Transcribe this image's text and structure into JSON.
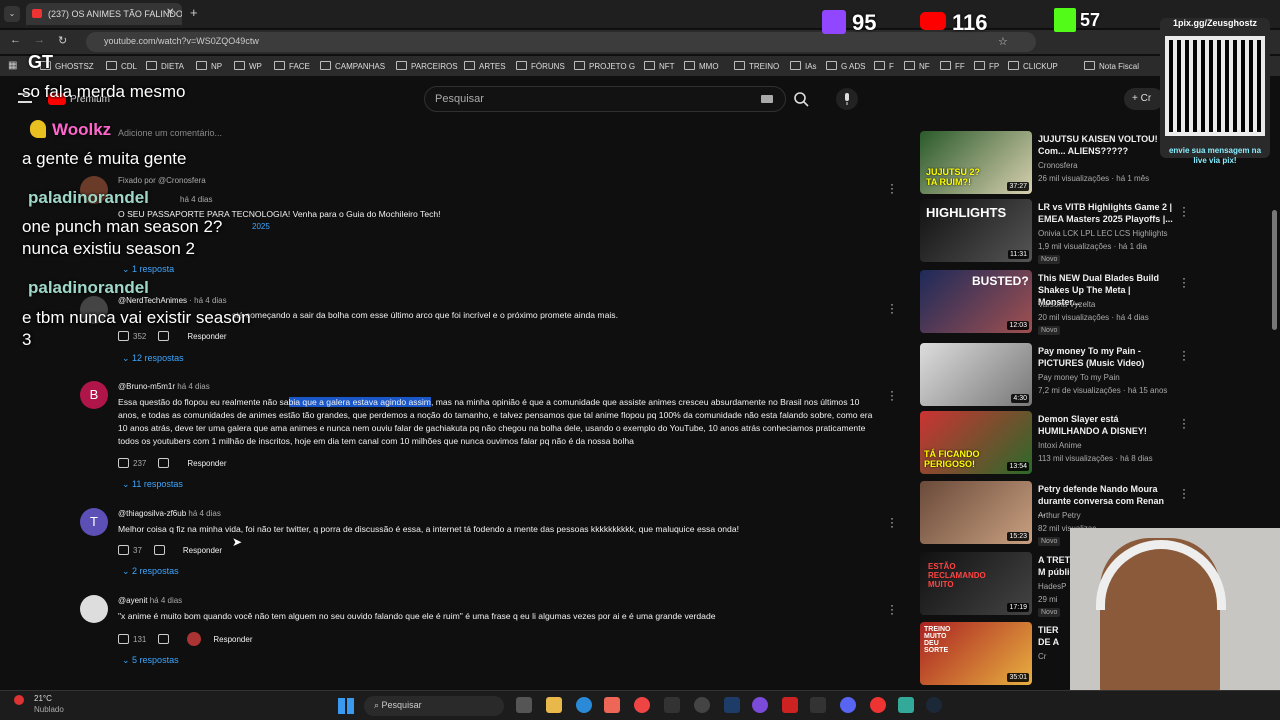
{
  "browser": {
    "tab_title": "(237) OS ANIMES TÃO FALINDO",
    "url": "youtube.com/watch?v=WS0ZQO49ctw"
  },
  "bookmarks": [
    "GHOSTSZ",
    "CDL",
    "DIETA",
    "NP",
    "WP",
    "FACE",
    "CAMPANHAS",
    "PARCEIROS",
    "ARTES",
    "FÓRUNS",
    "PROJETO G",
    "NFT",
    "MMO",
    "TREINO",
    "IAs",
    "G ADS",
    "F",
    "NF",
    "FF",
    "FP",
    "CLICKUP",
    "Nota Fiscal"
  ],
  "youtube": {
    "search_placeholder": "Pesquisar",
    "premium_label": "Premium",
    "add_comment": "Adicione um comentário...",
    "create_label": "Cr"
  },
  "comments": [
    {
      "pinned": "Fixado por @Cronosfera",
      "author": "",
      "time": "há 4 dias",
      "text": "O SEU PASSAPORTE PARA TECNOLOGIA! Venha para o Guia do Mochileiro Tech!",
      "extra": "2025",
      "replies": "1 resposta"
    },
    {
      "author": "@NerdTechAnimes",
      "time": "há 4 dias",
      "text": "stá começando a sair da bolha com esse último arco que foi incrível e o próximo promete ainda mais.",
      "likes": "352",
      "reply": "Responder",
      "replies": "12 respostas"
    },
    {
      "author": "@Bruno-m5m1r",
      "time": "há 4 dias",
      "avatar": "B",
      "text_a": "Essa questão do flopou eu realmente não sa",
      "text_hl": "bia que a galera estava agindo assim",
      "text_b": ", mas na minha opinião é que a comunidade que assiste animes cresceu absurdamente no Brasil nos últimos 10 anos, e todas as comunidades de animes estão tão grandes, que perdemos a noção do tamanho, e talvez pensamos que tal anime flopou pq 100% da comunidade não esta falando sobre, como era 10 anos atrás, deve ter uma galera que ama animes e nunca nem ouviu falar de gachiakuta pq não chegou na bolha dele, usando o exemplo do YouTube, 10 anos atrás conheciamos praticamente todos os youtubers com 1 milhão de inscritos, hoje em dia tem canal com 10 milhões que nunca ouvimos falar pq não é da nossa bolha",
      "likes": "237",
      "reply": "Responder",
      "replies": "11 respostas"
    },
    {
      "author": "@thiagosilva-zf6ub",
      "time": "há 4 dias",
      "avatar": "T",
      "text": "Melhor coisa q fiz na minha vida, foi não ter twitter, q porra de discussão é essa, a internet tá fodendo a mente das pessoas kkkkkkkkkk, que maluquice essa onda!",
      "likes": "37",
      "reply": "Responder",
      "replies": "2 respostas"
    },
    {
      "author": "@ayenit",
      "time": "há 4 dias",
      "text": "\"x anime é muito bom quando você não tem alguem no seu ouvido falando que ele é ruim\" é uma frase q eu li algumas vezes por ai e é uma grande verdade",
      "likes": "131",
      "reply": "Responder",
      "replies": "5 respostas"
    }
  ],
  "videos": [
    {
      "title": "JUJUTSU KAISEN VOLTOU! Com... ALIENS?????",
      "channel": "Cronosfera",
      "meta": "26 mil visualizações · há 1 mês",
      "dur": "37:27",
      "thumb_text": "JUJUTSU 2? TA RUIM?!",
      "new": ""
    },
    {
      "title": "LR vs VITB Highlights Game 2 | EMEA Masters 2025 Playoffs |...",
      "channel": "Onivia LCK LPL LEC LCS Highlights",
      "meta": "1,9 mil visualizações · há 1 dia",
      "dur": "11:31",
      "thumb_text": "HIGHLIGHTS",
      "new": "Novo"
    },
    {
      "title": "This NEW Dual Blades Build Shakes Up The Meta | Monster...",
      "channel": "Varsona Vyzelta",
      "meta": "20 mil visualizações · há 4 dias",
      "dur": "12:03",
      "thumb_text": "BUSTED?",
      "new": "Novo"
    },
    {
      "title": "Pay money To my Pain - PICTURES (Music Video)",
      "channel": "Pay money To my Pain",
      "meta": "7,2 mi de visualizações · há 15 anos",
      "dur": "4:30",
      "thumb_text": "",
      "new": ""
    },
    {
      "title": "Demon Slayer está HUMILHANDO A DISNEY!",
      "channel": "Intoxi Anime",
      "meta": "113 mil visualizações · há 8 dias",
      "dur": "13:54",
      "thumb_text": "TÁ FICANDO PERIGOSO!",
      "new": ""
    },
    {
      "title": "Petry defende Nando Moura durante conversa com Renan ...",
      "channel": "Arthur Petry",
      "meta": "82 mil visualizaç",
      "dur": "15:23",
      "thumb_text": "",
      "new": "Novo"
    },
    {
      "title": "A TRETA do M público e",
      "channel": "HadesP",
      "meta": "29 mi",
      "dur": "17:19",
      "thumb_text": "ESTÃO RECLAMANDO MUITO",
      "new": "Novo"
    },
    {
      "title": "TIER DE A",
      "channel": "Cr",
      "meta": "",
      "dur": "35:01",
      "thumb_text": "TREINO MUITO DEU SORTE",
      "new": ""
    }
  ],
  "stream": {
    "chat": [
      {
        "user": "",
        "msg": "so fala merda mesmo"
      },
      {
        "user": "Woolkz",
        "msg": "a gente é muita gente"
      },
      {
        "user": "paladinorandel",
        "msg": "one punch man season 2? nunca existiu season 2"
      },
      {
        "user": "paladinorandel",
        "msg": "e tbm nunca vai existir season 3"
      }
    ],
    "gt": "GT",
    "twitch_count": "95",
    "youtube_count": "116",
    "kick_count": "57",
    "pix_title": "1pix.gg/Zeusghostz",
    "pix_text": "envie sua mensagem na live via pix!"
  },
  "taskbar": {
    "temp": "21°C",
    "weather": "Nublado",
    "search": "Pesquisar"
  },
  "colors": {
    "accent": "#3ea6ff",
    "highlight": "#1a57c9",
    "twitch": "#9146ff",
    "youtube": "#ff0000",
    "kick": "#53fc18"
  }
}
